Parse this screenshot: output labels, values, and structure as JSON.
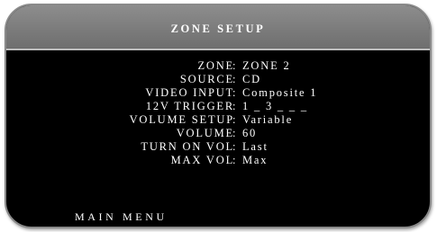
{
  "header": {
    "title": "ZONE SETUP"
  },
  "settings": [
    {
      "label": "ZONE",
      "value": "ZONE 2"
    },
    {
      "label": "SOURCE",
      "value": "CD"
    },
    {
      "label": "VIDEO INPUT",
      "value": "Composite 1"
    },
    {
      "label": "12V TRIGGER",
      "value": "1 _ 3 _ _ _"
    },
    {
      "label": "VOLUME SETUP",
      "value": "Variable"
    },
    {
      "label": "VOLUME",
      "value": "60"
    },
    {
      "label": "TURN ON VOL",
      "value": "Last"
    },
    {
      "label": "MAX VOL",
      "value": "Max"
    }
  ],
  "separator": ":",
  "footer": {
    "main_menu_label": "MAIN MENU"
  }
}
